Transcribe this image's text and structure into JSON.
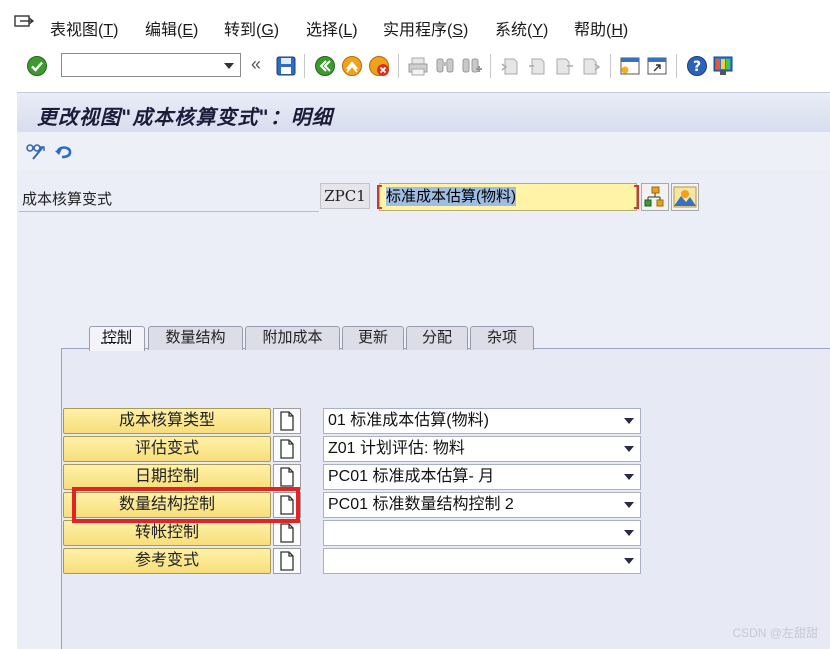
{
  "menu": {
    "items": [
      {
        "label": "表视图(",
        "key": "T",
        "tail": ")"
      },
      {
        "label": "编辑(",
        "key": "E",
        "tail": ")"
      },
      {
        "label": "转到(",
        "key": "G",
        "tail": ")"
      },
      {
        "label": "选择(",
        "key": "L",
        "tail": ")"
      },
      {
        "label": "实用程序(",
        "key": "S",
        "tail": ")"
      },
      {
        "label": "系统(",
        "key": "Y",
        "tail": ")"
      },
      {
        "label": "帮助(",
        "key": "H",
        "tail": ")"
      }
    ]
  },
  "toolbar": {
    "command_value": "",
    "icons": [
      "enter-icon",
      "back-double-icon",
      "save-icon",
      "back-icon",
      "exit-icon",
      "cancel-icon",
      "print-icon",
      "find-icon",
      "find-next-icon",
      "first-page-icon",
      "prev-page-icon",
      "next-page-icon",
      "last-page-icon",
      "new-session-icon",
      "shortcut-icon",
      "help-icon",
      "layout-icon"
    ]
  },
  "title": "更改视图\"成本核算变式\"：明细",
  "header": {
    "field_label": "成本核算变式",
    "key_value": "ZPC1",
    "desc_value": "标准成本估算(物料)"
  },
  "tabs": [
    {
      "label": "控制",
      "active": true
    },
    {
      "label": "数量结构",
      "active": false
    },
    {
      "label": "附加成本",
      "active": false
    },
    {
      "label": "更新",
      "active": false
    },
    {
      "label": "分配",
      "active": false
    },
    {
      "label": "杂项",
      "active": false
    }
  ],
  "rows": [
    {
      "label": "成本核算类型",
      "value": "01 标准成本估算(物料)"
    },
    {
      "label": "评估变式",
      "value": "Z01 计划评估: 物料"
    },
    {
      "label": "日期控制",
      "value": "PC01 标准成本估算- 月"
    },
    {
      "label": "数量结构控制",
      "value": "PC01 标准数量结构控制 2"
    },
    {
      "label": "转帐控制",
      "value": ""
    },
    {
      "label": "参考变式",
      "value": ""
    }
  ],
  "watermark": "CSDN @左甜甜",
  "colors": {
    "title_bg": "#d7ddee",
    "button_yellow": "#f7de7b",
    "highlight_red": "#e12424",
    "field_yellow": "#fff3a7"
  }
}
